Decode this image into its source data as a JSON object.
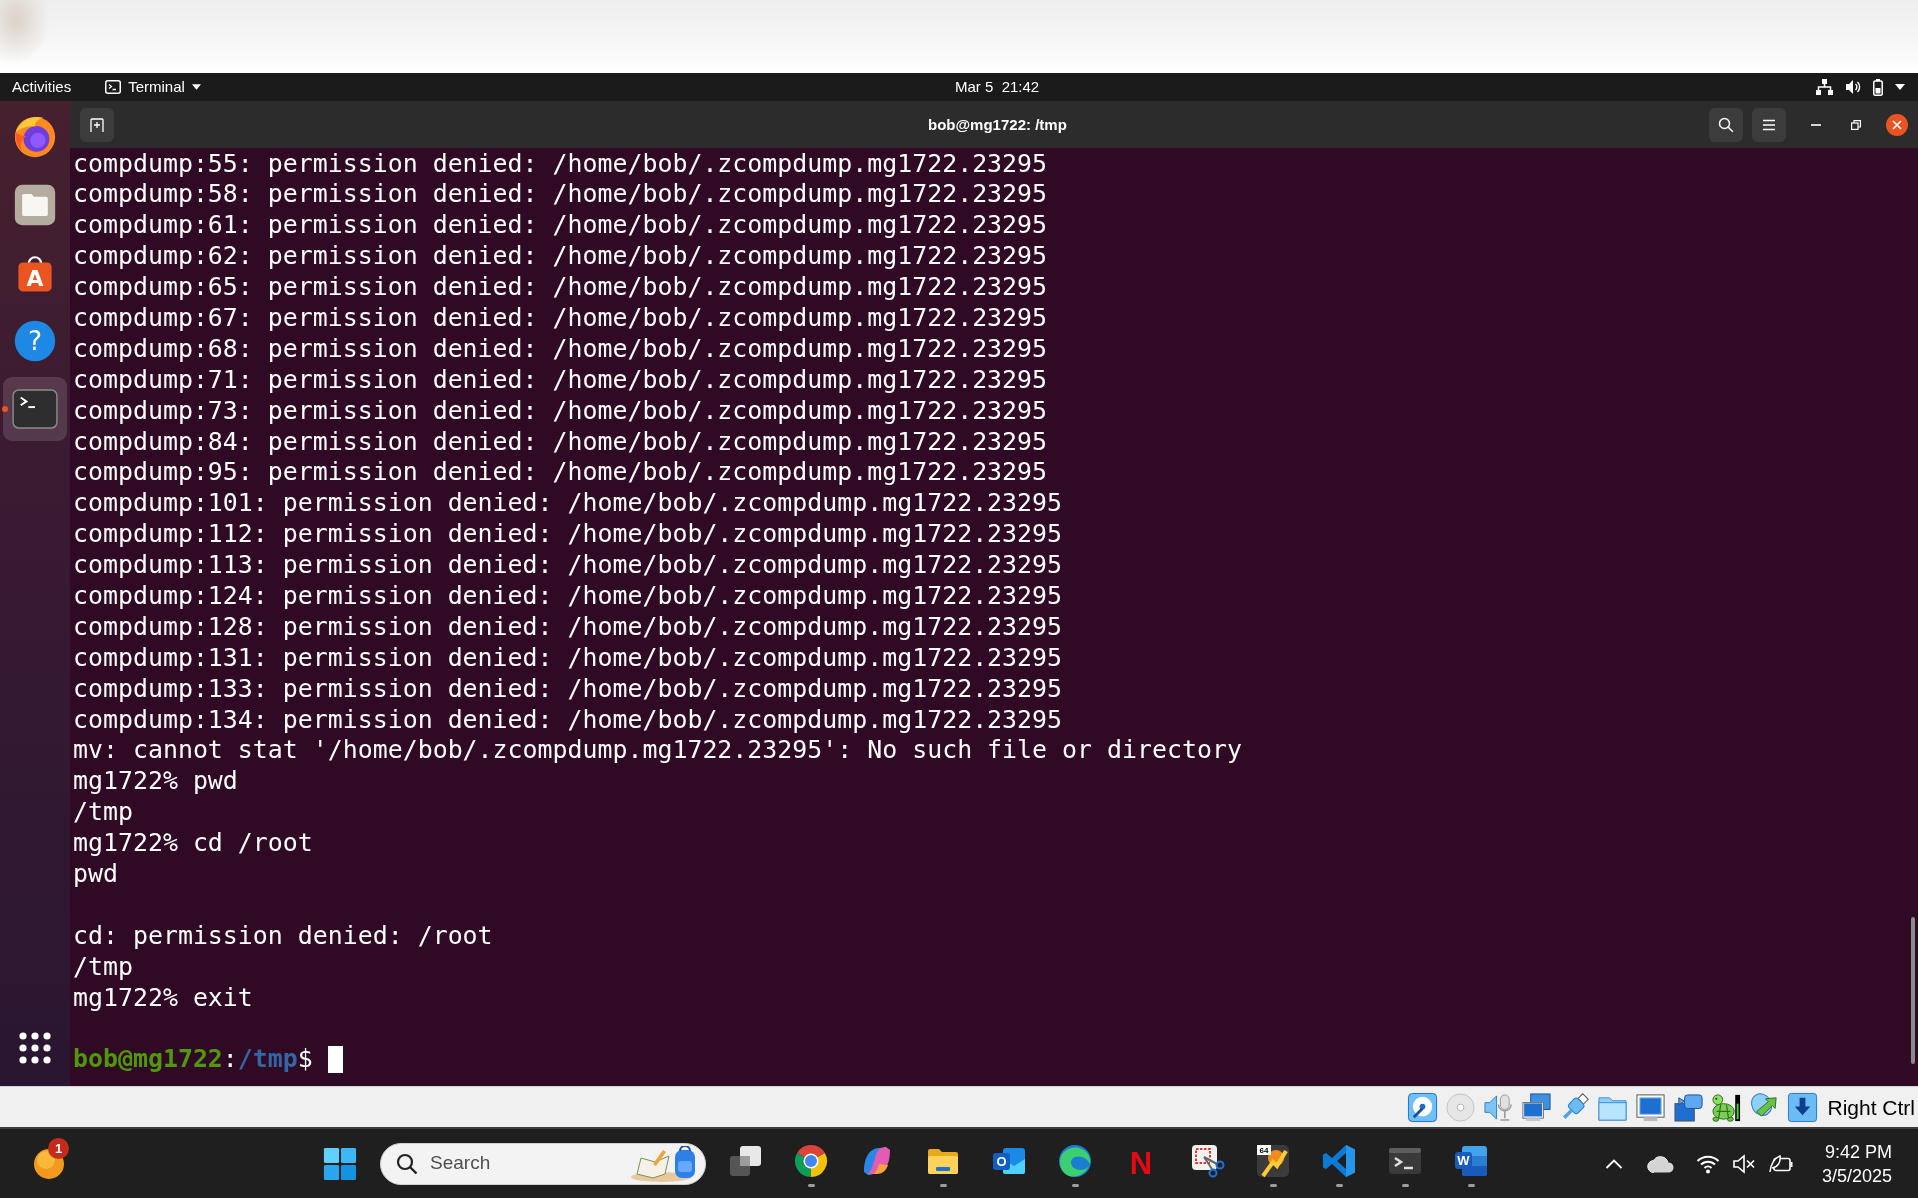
{
  "top_bar": {
    "activities": "Activities",
    "app_menu": "Terminal",
    "clock": "Mar 5  21:42"
  },
  "dock": {
    "items": [
      {
        "selected": false,
        "running": false
      },
      {
        "selected": false,
        "running": false
      },
      {
        "selected": false,
        "running": false,
        "glyph": "A"
      },
      {
        "selected": false,
        "running": false,
        "glyph": "?"
      },
      {
        "selected": true,
        "running": true
      }
    ]
  },
  "terminal": {
    "title": "bob@mg1722: /tmp",
    "lines": [
      {
        "kind": "output",
        "text": "compdump:55: permission denied: /home/bob/.zcompdump.mg1722.23295"
      },
      {
        "kind": "output",
        "text": "compdump:58: permission denied: /home/bob/.zcompdump.mg1722.23295"
      },
      {
        "kind": "output",
        "text": "compdump:61: permission denied: /home/bob/.zcompdump.mg1722.23295"
      },
      {
        "kind": "output",
        "text": "compdump:62: permission denied: /home/bob/.zcompdump.mg1722.23295"
      },
      {
        "kind": "output",
        "text": "compdump:65: permission denied: /home/bob/.zcompdump.mg1722.23295"
      },
      {
        "kind": "output",
        "text": "compdump:67: permission denied: /home/bob/.zcompdump.mg1722.23295"
      },
      {
        "kind": "output",
        "text": "compdump:68: permission denied: /home/bob/.zcompdump.mg1722.23295"
      },
      {
        "kind": "output",
        "text": "compdump:71: permission denied: /home/bob/.zcompdump.mg1722.23295"
      },
      {
        "kind": "output",
        "text": "compdump:73: permission denied: /home/bob/.zcompdump.mg1722.23295"
      },
      {
        "kind": "output",
        "text": "compdump:84: permission denied: /home/bob/.zcompdump.mg1722.23295"
      },
      {
        "kind": "output",
        "text": "compdump:95: permission denied: /home/bob/.zcompdump.mg1722.23295"
      },
      {
        "kind": "output",
        "text": "compdump:101: permission denied: /home/bob/.zcompdump.mg1722.23295"
      },
      {
        "kind": "output",
        "text": "compdump:112: permission denied: /home/bob/.zcompdump.mg1722.23295"
      },
      {
        "kind": "output",
        "text": "compdump:113: permission denied: /home/bob/.zcompdump.mg1722.23295"
      },
      {
        "kind": "output",
        "text": "compdump:124: permission denied: /home/bob/.zcompdump.mg1722.23295"
      },
      {
        "kind": "output",
        "text": "compdump:128: permission denied: /home/bob/.zcompdump.mg1722.23295"
      },
      {
        "kind": "output",
        "text": "compdump:131: permission denied: /home/bob/.zcompdump.mg1722.23295"
      },
      {
        "kind": "output",
        "text": "compdump:133: permission denied: /home/bob/.zcompdump.mg1722.23295"
      },
      {
        "kind": "output",
        "text": "compdump:134: permission denied: /home/bob/.zcompdump.mg1722.23295"
      },
      {
        "kind": "output",
        "text": "mv: cannot stat '/home/bob/.zcompdump.mg1722.23295': No such file or directory"
      },
      {
        "kind": "output",
        "text": "mg1722% pwd"
      },
      {
        "kind": "output",
        "text": "/tmp"
      },
      {
        "kind": "output",
        "text": "mg1722% cd /root"
      },
      {
        "kind": "output",
        "text": "pwd"
      },
      {
        "kind": "blank"
      },
      {
        "kind": "output",
        "text": "cd: permission denied: /root"
      },
      {
        "kind": "output",
        "text": "/tmp"
      },
      {
        "kind": "output",
        "text": "mg1722% exit"
      },
      {
        "kind": "blank"
      },
      {
        "kind": "prompt",
        "user_host": "bob@mg1722",
        "separator": ":",
        "path": "/tmp",
        "symbol": "$",
        "cursor": true
      }
    ]
  },
  "vm_status_bar": {
    "host_key": "Right Ctrl"
  },
  "taskbar": {
    "widget_badge": "1",
    "search": {
      "placeholder": "Search"
    },
    "apps": [
      {
        "running": false
      },
      {
        "running": true
      },
      {
        "running": false
      },
      {
        "running": true
      },
      {
        "running": false,
        "glyph": "O"
      },
      {
        "running": true
      },
      {
        "running": false,
        "glyph": "N"
      },
      {
        "running": false
      },
      {
        "running": true,
        "glyph": "64"
      },
      {
        "running": true
      },
      {
        "running": true
      },
      {
        "running": true,
        "glyph": "W"
      }
    ],
    "tray": {
      "muted": true,
      "time": "9:42 PM",
      "date": "3/5/2025"
    }
  }
}
